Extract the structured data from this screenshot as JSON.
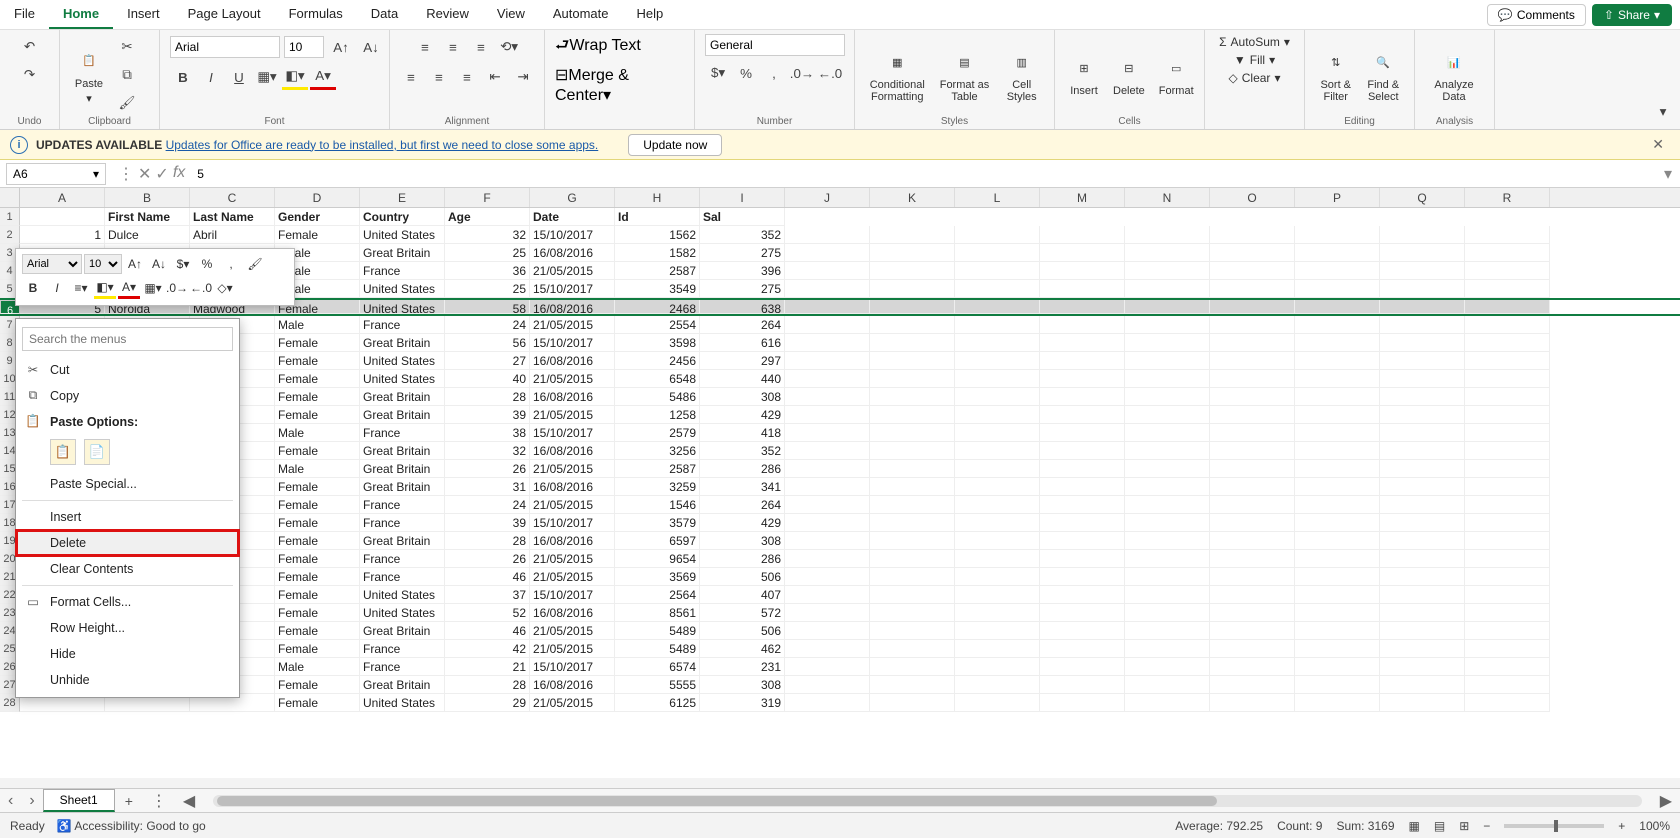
{
  "menubar": {
    "items": [
      "File",
      "Home",
      "Insert",
      "Page Layout",
      "Formulas",
      "Data",
      "Review",
      "View",
      "Automate",
      "Help"
    ],
    "active": "Home",
    "comments": "Comments",
    "share": "Share"
  },
  "ribbon": {
    "undo": "Undo",
    "clipboard": {
      "label": "Clipboard",
      "paste": "Paste"
    },
    "font": {
      "label": "Font",
      "name": "Arial",
      "size": "10"
    },
    "alignment": {
      "label": "Alignment",
      "wrap": "Wrap Text",
      "merge": "Merge & Center"
    },
    "number": {
      "label": "Number",
      "format": "General"
    },
    "styles": {
      "label": "Styles",
      "cf": "Conditional Formatting",
      "fat": "Format as Table",
      "cs": "Cell Styles"
    },
    "cells": {
      "label": "Cells",
      "insert": "Insert",
      "delete": "Delete",
      "format": "Format"
    },
    "editing": {
      "label": "Editing",
      "autosum": "AutoSum",
      "fill": "Fill",
      "clear": "Clear",
      "sort": "Sort & Filter",
      "find": "Find & Select"
    },
    "analysis": {
      "label": "Analysis",
      "analyze": "Analyze Data"
    }
  },
  "update": {
    "title": "UPDATES AVAILABLE",
    "msg": "Updates for Office are ready to be installed, but first we need to close some apps.",
    "btn": "Update now"
  },
  "namebox": "A6",
  "formula": "5",
  "columns": [
    "A",
    "B",
    "C",
    "D",
    "E",
    "F",
    "G",
    "H",
    "I",
    "J",
    "K",
    "L",
    "M",
    "N",
    "O",
    "P",
    "Q",
    "R"
  ],
  "headers": [
    "",
    "First Name",
    "Last Name",
    "Gender",
    "Country",
    "Age",
    "Date",
    "Id",
    "Sal"
  ],
  "rows": [
    [
      "1",
      "Dulce",
      "Abril",
      "Female",
      "United States",
      "32",
      "15/10/2017",
      "1562",
      "352"
    ],
    [
      "",
      "",
      "",
      "emale",
      "Great Britain",
      "25",
      "16/08/2016",
      "1582",
      "275"
    ],
    [
      "",
      "",
      "",
      "emale",
      "France",
      "36",
      "21/05/2015",
      "2587",
      "396"
    ],
    [
      "",
      "",
      "",
      "emale",
      "United States",
      "25",
      "15/10/2017",
      "3549",
      "275"
    ],
    [
      "5",
      "Noroida",
      "Magwood",
      "Female",
      "United States",
      "58",
      "16/08/2016",
      "2468",
      "638"
    ],
    [
      "",
      "",
      "",
      "Male",
      "France",
      "24",
      "21/05/2015",
      "2554",
      "264"
    ],
    [
      "",
      "",
      "",
      "Female",
      "Great Britain",
      "56",
      "15/10/2017",
      "3598",
      "616"
    ],
    [
      "",
      "",
      "",
      "Female",
      "United States",
      "27",
      "16/08/2016",
      "2456",
      "297"
    ],
    [
      "",
      "",
      "d",
      "Female",
      "United States",
      "40",
      "21/05/2015",
      "6548",
      "440"
    ],
    [
      "",
      "",
      "rd",
      "Female",
      "Great Britain",
      "28",
      "16/08/2016",
      "5486",
      "308"
    ],
    [
      "",
      "",
      "a",
      "Female",
      "Great Britain",
      "39",
      "21/05/2015",
      "1258",
      "429"
    ],
    [
      "",
      "",
      "w",
      "Male",
      "France",
      "38",
      "15/10/2017",
      "2579",
      "418"
    ],
    [
      "",
      "",
      "cio",
      "Female",
      "Great Britain",
      "32",
      "16/08/2016",
      "3256",
      "352"
    ],
    [
      "",
      "",
      "kie",
      "Male",
      "Great Britain",
      "26",
      "21/05/2015",
      "2587",
      "286"
    ],
    [
      "",
      "",
      "on",
      "Female",
      "Great Britain",
      "31",
      "16/08/2016",
      "3259",
      "341"
    ],
    [
      "",
      "",
      "",
      "Female",
      "France",
      "24",
      "21/05/2015",
      "1546",
      "264"
    ],
    [
      "",
      "",
      "",
      "Female",
      "France",
      "39",
      "15/10/2017",
      "3579",
      "429"
    ],
    [
      "",
      "",
      "e",
      "Female",
      "Great Britain",
      "28",
      "16/08/2016",
      "6597",
      "308"
    ],
    [
      "",
      "",
      "",
      "Female",
      "France",
      "26",
      "21/05/2015",
      "9654",
      "286"
    ],
    [
      "",
      "",
      "",
      "Female",
      "France",
      "46",
      "21/05/2015",
      "3569",
      "506"
    ],
    [
      "",
      "",
      "",
      "Female",
      "United States",
      "37",
      "15/10/2017",
      "2564",
      "407"
    ],
    [
      "",
      "",
      "",
      "Female",
      "United States",
      "52",
      "16/08/2016",
      "8561",
      "572"
    ],
    [
      "",
      "",
      "rd",
      "Female",
      "Great Britain",
      "46",
      "21/05/2015",
      "5489",
      "506"
    ],
    [
      "",
      "",
      "",
      "Female",
      "France",
      "42",
      "21/05/2015",
      "5489",
      "462"
    ],
    [
      "",
      "",
      "o",
      "Male",
      "France",
      "21",
      "15/10/2017",
      "6574",
      "231"
    ],
    [
      "",
      "",
      "",
      "Female",
      "Great Britain",
      "28",
      "16/08/2016",
      "5555",
      "308"
    ],
    [
      "",
      "",
      "",
      "Female",
      "United States",
      "29",
      "21/05/2015",
      "6125",
      "319"
    ]
  ],
  "selected_row_index": 4,
  "mini": {
    "font": "Arial",
    "size": "10"
  },
  "context": {
    "search_ph": "Search the menus",
    "cut": "Cut",
    "copy": "Copy",
    "paste_options": "Paste Options:",
    "paste_special": "Paste Special...",
    "insert": "Insert",
    "delete": "Delete",
    "clear": "Clear Contents",
    "format_cells": "Format Cells...",
    "row_height": "Row Height...",
    "hide": "Hide",
    "unhide": "Unhide"
  },
  "sheet": {
    "name": "Sheet1"
  },
  "status": {
    "ready": "Ready",
    "access": "Accessibility: Good to go",
    "avg": "Average: 792.25",
    "count": "Count: 9",
    "sum": "Sum: 3169",
    "zoom": "100%"
  }
}
